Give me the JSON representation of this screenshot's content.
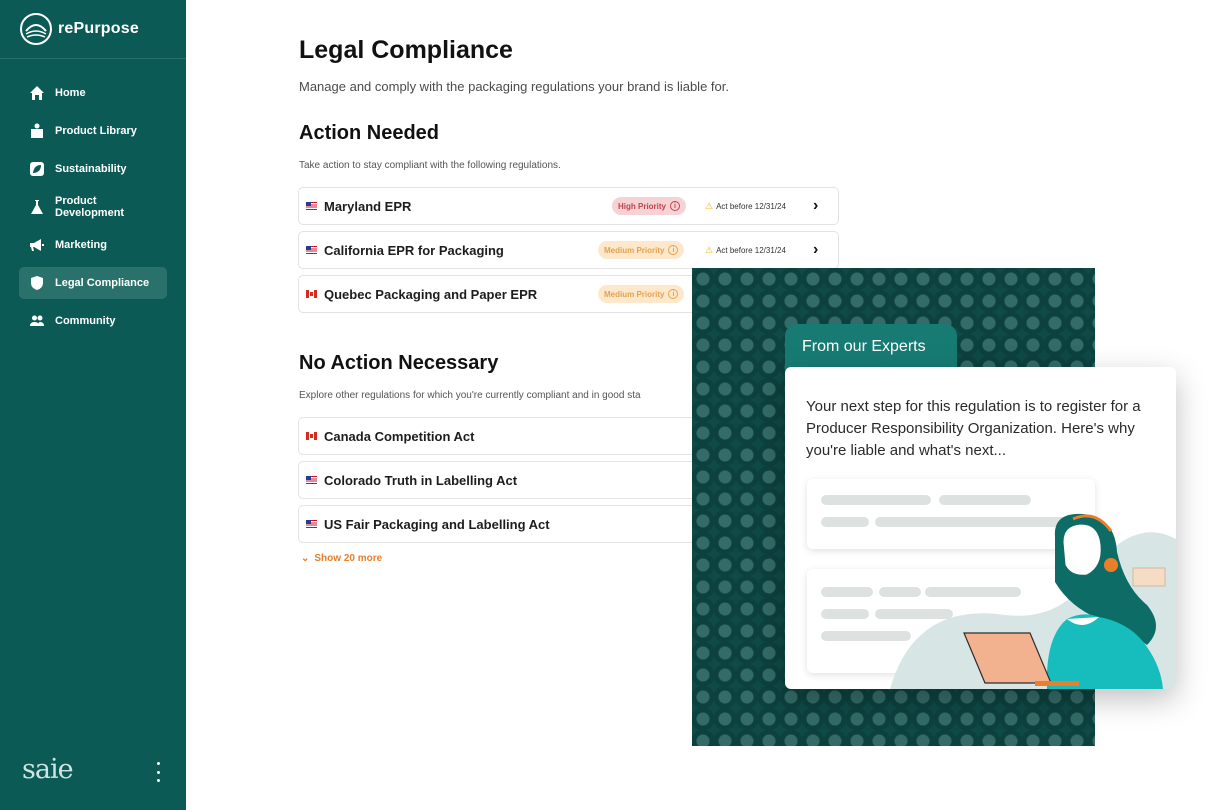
{
  "brand": {
    "name": "rePurpose",
    "footer_logo": "saie"
  },
  "sidebar": {
    "items": [
      {
        "label": "Home",
        "icon": "home-icon"
      },
      {
        "label": "Product Library",
        "icon": "box-icon"
      },
      {
        "label": "Sustainability",
        "icon": "leaf-icon"
      },
      {
        "label": "Product Development",
        "icon": "flask-icon"
      },
      {
        "label": "Marketing",
        "icon": "megaphone-icon"
      },
      {
        "label": "Legal Compliance",
        "icon": "shield-icon",
        "active": true
      },
      {
        "label": "Community",
        "icon": "people-icon"
      }
    ]
  },
  "main": {
    "title": "Legal Compliance",
    "subtitle": "Manage and comply with the packaging regulations your brand is liable for.",
    "action_needed": {
      "title": "Action Needed",
      "description": "Take action to stay compliant with the following regulations.",
      "rows": [
        {
          "flag": "us",
          "name": "Maryland EPR",
          "priority": "High Priority",
          "priority_level": "high",
          "deadline": "Act before 12/31/24"
        },
        {
          "flag": "us",
          "name": "California EPR for Packaging",
          "priority": "Medium Priority",
          "priority_level": "medium",
          "deadline": "Act before 12/31/24"
        },
        {
          "flag": "ca",
          "name": "Quebec Packaging and Paper EPR",
          "priority": "Medium Priority",
          "priority_level": "medium",
          "deadline": ""
        }
      ]
    },
    "no_action": {
      "title": "No Action Necessary",
      "description": "Explore other regulations for which you're currently compliant and in good sta",
      "rows": [
        {
          "flag": "ca",
          "name": "Canada Competition Act"
        },
        {
          "flag": "us",
          "name": "Colorado Truth in Labelling Act"
        },
        {
          "flag": "us",
          "name": "US Fair Packaging and Labelling Act"
        }
      ],
      "show_more": "Show 20 more"
    }
  },
  "expert": {
    "tab": "From our Experts",
    "text": "Your next step for this regulation is to register for a Producer Responsibility Organization. Here's why you're liable and what's next..."
  },
  "colors": {
    "sidebar": "#0b5a55",
    "accent_teal": "#177b74",
    "high": "#c2424a",
    "medium": "#e6a24f",
    "link": "#e97f2b"
  }
}
